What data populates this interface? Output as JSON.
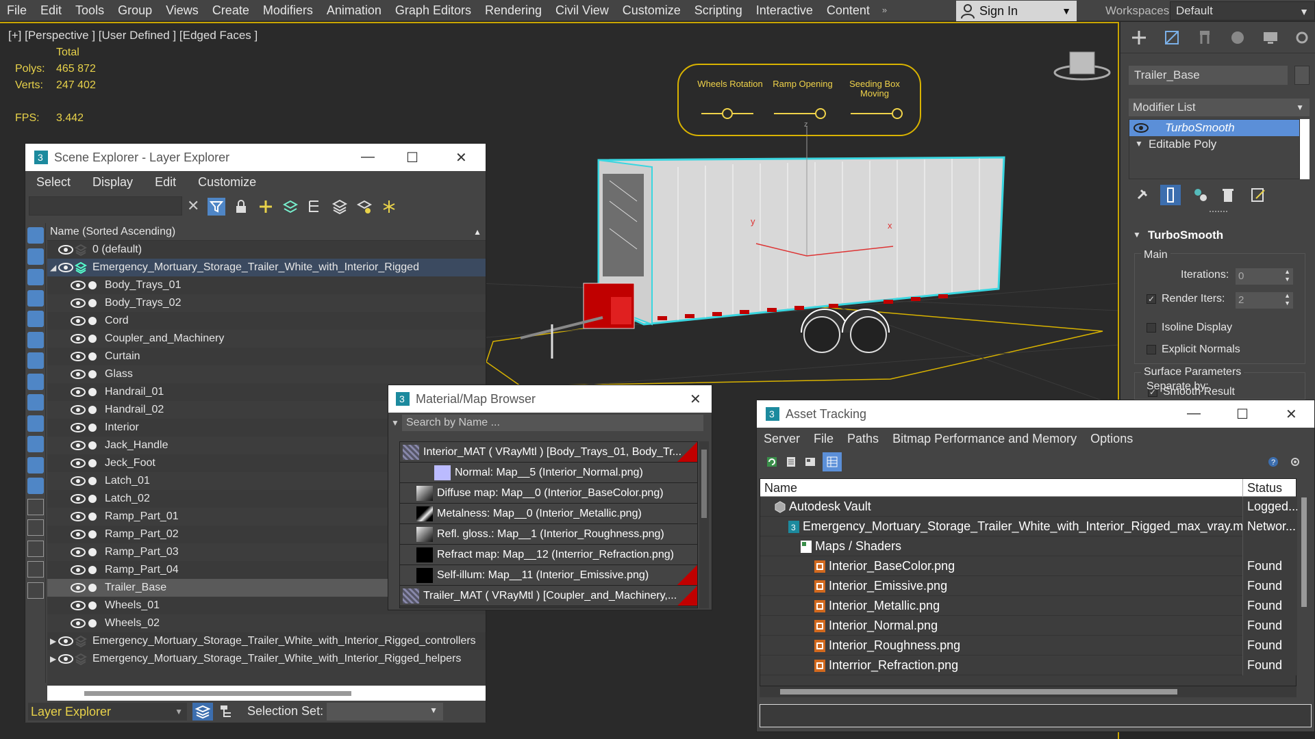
{
  "menu": {
    "items": [
      "File",
      "Edit",
      "Tools",
      "Group",
      "Views",
      "Create",
      "Modifiers",
      "Animation",
      "Graph Editors",
      "Rendering",
      "Civil View",
      "Customize",
      "Scripting",
      "Interactive",
      "Content"
    ],
    "more": "»",
    "sign_in": "Sign In",
    "workspaces_label": "Workspaces:",
    "workspaces_value": "Default"
  },
  "viewport": {
    "label": "[+] [Perspective ] [User Defined ] [Edged Faces ]",
    "stats": {
      "total": "Total",
      "polys_label": "Polys:",
      "polys_value": "465 872",
      "verts_label": "Verts:",
      "verts_value": "247 402",
      "fps_label": "FPS:",
      "fps_value": "3.442"
    },
    "controls": [
      {
        "label": "Wheels Rotation",
        "value": 0.5
      },
      {
        "label": "Ramp Opening",
        "value": 1.0
      },
      {
        "label": "Seeding Box Moving",
        "value": 1.0
      }
    ],
    "axis_z": "z",
    "axis_y": "y",
    "axis_x": "x"
  },
  "scene_explorer": {
    "title": "Scene Explorer - Layer Explorer",
    "menu": [
      "Select",
      "Display",
      "Edit",
      "Customize"
    ],
    "column_header": "Name (Sorted Ascending)",
    "rows": [
      {
        "label": "0 (default)",
        "level": 0,
        "type": "layer"
      },
      {
        "label": "Emergency_Mortuary_Storage_Trailer_White_with_Interior_Rigged",
        "level": 0,
        "type": "layer",
        "expanded": true,
        "selected": true
      },
      {
        "label": "Body_Trays_01",
        "level": 1,
        "type": "object"
      },
      {
        "label": "Body_Trays_02",
        "level": 1,
        "type": "object"
      },
      {
        "label": "Cord",
        "level": 1,
        "type": "object"
      },
      {
        "label": "Coupler_and_Machinery",
        "level": 1,
        "type": "object"
      },
      {
        "label": "Curtain",
        "level": 1,
        "type": "object"
      },
      {
        "label": "Glass",
        "level": 1,
        "type": "object"
      },
      {
        "label": "Handrail_01",
        "level": 1,
        "type": "object"
      },
      {
        "label": "Handrail_02",
        "level": 1,
        "type": "object"
      },
      {
        "label": "Interior",
        "level": 1,
        "type": "object"
      },
      {
        "label": "Jack_Handle",
        "level": 1,
        "type": "object"
      },
      {
        "label": "Jeck_Foot",
        "level": 1,
        "type": "object"
      },
      {
        "label": "Latch_01",
        "level": 1,
        "type": "object"
      },
      {
        "label": "Latch_02",
        "level": 1,
        "type": "object"
      },
      {
        "label": "Ramp_Part_01",
        "level": 1,
        "type": "object"
      },
      {
        "label": "Ramp_Part_02",
        "level": 1,
        "type": "object"
      },
      {
        "label": "Ramp_Part_03",
        "level": 1,
        "type": "object"
      },
      {
        "label": "Ramp_Part_04",
        "level": 1,
        "type": "object"
      },
      {
        "label": "Trailer_Base",
        "level": 1,
        "type": "object",
        "highlight": true
      },
      {
        "label": "Wheels_01",
        "level": 1,
        "type": "object"
      },
      {
        "label": "Wheels_02",
        "level": 1,
        "type": "object"
      },
      {
        "label": "Emergency_Mortuary_Storage_Trailer_White_with_Interior_Rigged_controllers",
        "level": 0,
        "type": "layer",
        "collapsed": true
      },
      {
        "label": "Emergency_Mortuary_Storage_Trailer_White_with_Interior_Rigged_helpers",
        "level": 0,
        "type": "layer",
        "collapsed": true
      }
    ],
    "bottom": {
      "explorer_dropdown": "Layer Explorer",
      "selection_set_label": "Selection Set:"
    }
  },
  "material_browser": {
    "title": "Material/Map Browser",
    "search_placeholder": "Search by Name ...",
    "rows": [
      {
        "label": "Interior_MAT  ( VRayMtl )  [Body_Trays_01, Body_Tr...",
        "level": 0,
        "thumb": "mat",
        "red": true
      },
      {
        "label": "Normal: Map__5 (Interior_Normal.png)",
        "level": 2,
        "thumb": "lavender"
      },
      {
        "label": "Diffuse map: Map__0 (Interior_BaseColor.png)",
        "level": 1,
        "thumb": "texture"
      },
      {
        "label": "Metalness: Map__0 (Interior_Metallic.png)",
        "level": 1,
        "thumb": "dark"
      },
      {
        "label": "Refl. gloss.: Map__1 (Interior_Roughness.png)",
        "level": 1,
        "thumb": "texture"
      },
      {
        "label": "Refract map: Map__12 (Interrior_Refraction.png)",
        "level": 1,
        "thumb": "black"
      },
      {
        "label": "Self-illum: Map__11 (Interior_Emissive.png)",
        "level": 1,
        "thumb": "black",
        "red": true
      },
      {
        "label": "Trailer_MAT  ( VRayMtl )  [Coupler_and_Machinery,...",
        "level": 0,
        "thumb": "mat",
        "red": true
      }
    ]
  },
  "asset_tracking": {
    "title": "Asset Tracking",
    "menu": [
      "Server",
      "File",
      "Paths",
      "Bitmap Performance and Memory",
      "Options"
    ],
    "col_name": "Name",
    "col_status": "Status",
    "rows": [
      {
        "name": "Autodesk Vault",
        "status": "Logged...",
        "level": 0,
        "icon": "vault"
      },
      {
        "name": "Emergency_Mortuary_Storage_Trailer_White_with_Interior_Rigged_max_vray.max",
        "status": "Networ...",
        "level": 1,
        "icon": "max"
      },
      {
        "name": "Maps / Shaders",
        "status": "",
        "level": 2,
        "icon": "maps"
      },
      {
        "name": "Interior_BaseColor.png",
        "status": "Found",
        "level": 3,
        "icon": "png"
      },
      {
        "name": "Interior_Emissive.png",
        "status": "Found",
        "level": 3,
        "icon": "png"
      },
      {
        "name": "Interior_Metallic.png",
        "status": "Found",
        "level": 3,
        "icon": "png"
      },
      {
        "name": "Interior_Normal.png",
        "status": "Found",
        "level": 3,
        "icon": "png"
      },
      {
        "name": "Interior_Roughness.png",
        "status": "Found",
        "level": 3,
        "icon": "png"
      },
      {
        "name": "Interrior_Refraction.png",
        "status": "Found",
        "level": 3,
        "icon": "png"
      }
    ]
  },
  "command_panel": {
    "object_name": "Trailer_Base",
    "modifier_list": "Modifier List",
    "stack": [
      "TurboSmooth",
      "Editable Poly"
    ],
    "rollout_title": "TurboSmooth",
    "main_label": "Main",
    "iterations_label": "Iterations:",
    "iterations_value": "0",
    "render_iters_label": "Render Iters:",
    "render_iters_value": "2",
    "isoline_label": "Isoline Display",
    "explicit_normals_label": "Explicit Normals",
    "surface_params_label": "Surface Parameters",
    "smooth_result_label": "Smooth Result",
    "separate_by_label": "Separate by:"
  },
  "colors": {
    "stats_yellow": "#e8d24a",
    "selection_blue": "#5b8fd8",
    "wire_cyan": "#39d6e0",
    "grid_orange": "#d9b300",
    "red_accent": "#c00000"
  }
}
